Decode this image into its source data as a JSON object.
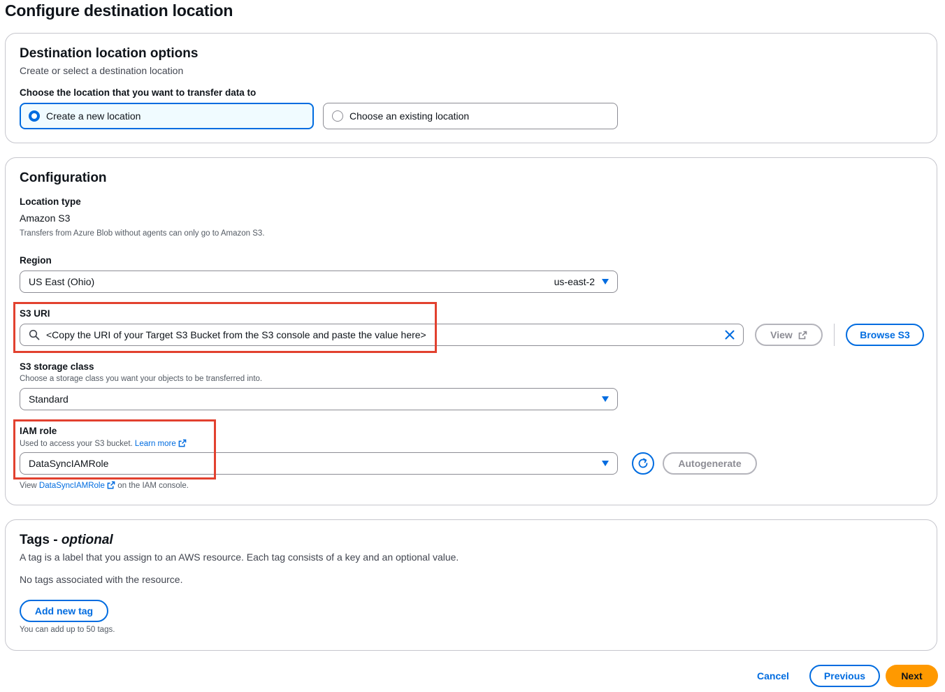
{
  "page": {
    "title": "Configure destination location"
  },
  "destination_options": {
    "heading": "Destination location options",
    "description": "Create or select a destination location",
    "question": "Choose the location that you want to transfer data to",
    "choices": [
      {
        "label": "Create a new location",
        "selected": true
      },
      {
        "label": "Choose an existing location",
        "selected": false
      }
    ]
  },
  "configuration": {
    "heading": "Configuration",
    "location_type": {
      "label": "Location type",
      "value": "Amazon S3",
      "note": "Transfers from Azure Blob without agents can only go to Amazon S3."
    },
    "region": {
      "label": "Region",
      "value": "US East (Ohio)",
      "code": "us-east-2"
    },
    "s3_uri": {
      "label": "S3 URI",
      "value": "<Copy the URI of your Target S3 Bucket from the S3 console and paste the value here>",
      "view_label": "View",
      "browse_label": "Browse S3"
    },
    "storage_class": {
      "label": "S3 storage class",
      "description": "Choose a storage class you want your objects to be transferred into.",
      "value": "Standard"
    },
    "iam_role": {
      "label": "IAM role",
      "description": "Used to access your S3 bucket.",
      "learn_more": "Learn more",
      "value": "DataSyncIAMRole",
      "autogenerate_label": "Autogenerate",
      "footer_prefix": "View",
      "footer_link": "DataSyncIAMRole",
      "footer_suffix": "on the IAM console."
    }
  },
  "tags": {
    "heading": "Tags - ",
    "heading_optional": "optional",
    "description": "A tag is a label that you assign to an AWS resource. Each tag consists of a key and an optional value.",
    "empty": "No tags associated with the resource.",
    "add_label": "Add new tag",
    "limit_note": "You can add up to 50 tags."
  },
  "footer": {
    "cancel": "Cancel",
    "previous": "Previous",
    "next": "Next"
  },
  "colors": {
    "accent": "#006ce0",
    "highlight": "#e2412f",
    "primary": "#ff9900"
  }
}
